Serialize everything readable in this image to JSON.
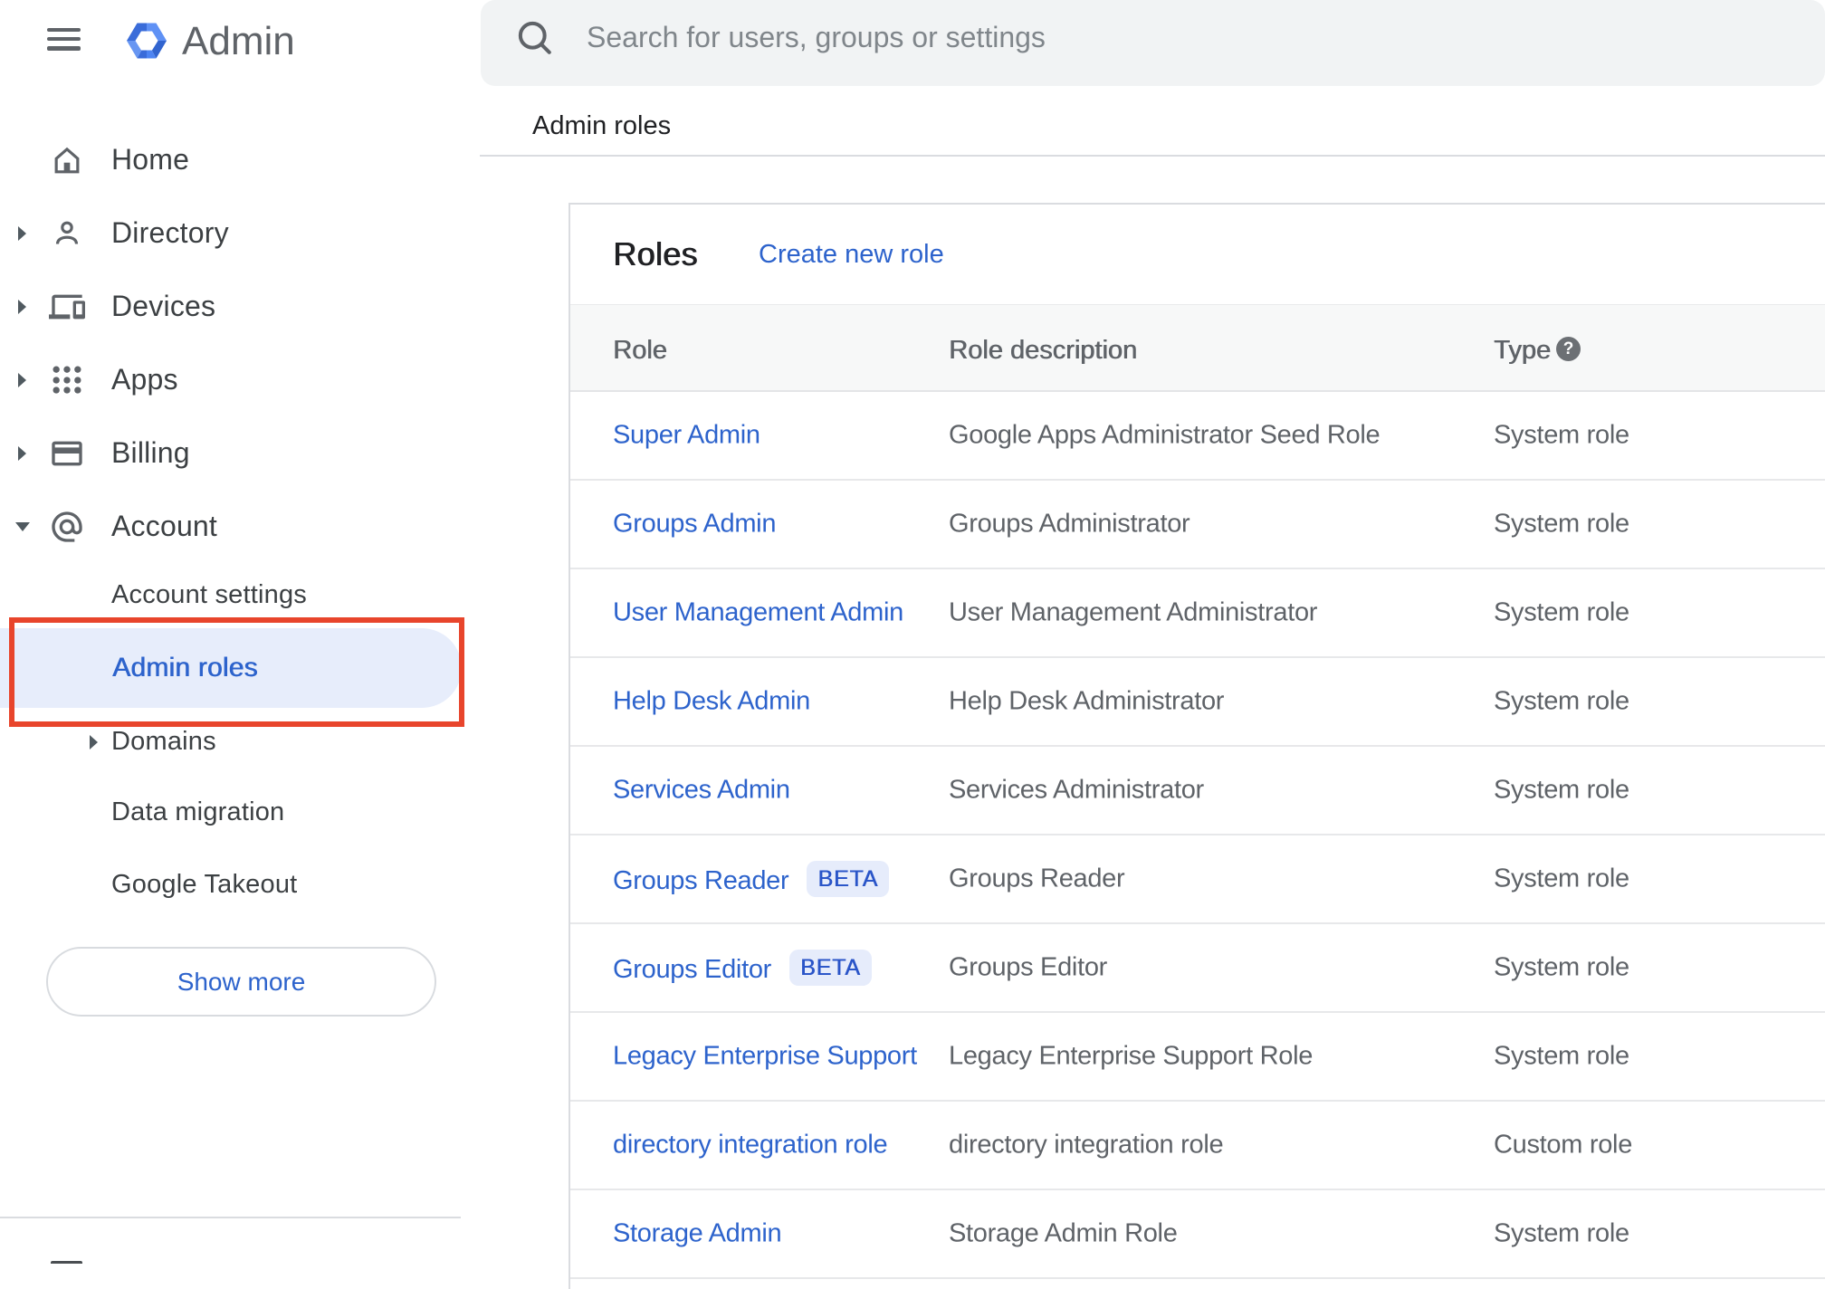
{
  "header": {
    "product_name": "Admin",
    "search_placeholder": "Search for users, groups or settings"
  },
  "breadcrumb": {
    "title": "Admin roles"
  },
  "sidebar": {
    "items": [
      {
        "label": "Home",
        "icon": "home-icon",
        "expandable": false
      },
      {
        "label": "Directory",
        "icon": "person-icon",
        "expandable": true
      },
      {
        "label": "Devices",
        "icon": "devices-icon",
        "expandable": true
      },
      {
        "label": "Apps",
        "icon": "apps-grid-icon",
        "expandable": true
      },
      {
        "label": "Billing",
        "icon": "credit-card-icon",
        "expandable": true
      },
      {
        "label": "Account",
        "icon": "at-sign-icon",
        "expandable": true,
        "expanded": true
      }
    ],
    "account_children": [
      {
        "label": "Account settings"
      },
      {
        "label": "Admin roles",
        "active": true
      },
      {
        "label": "Domains",
        "expandable": true
      },
      {
        "label": "Data migration"
      },
      {
        "label": "Google Takeout"
      }
    ],
    "show_more_label": "Show more"
  },
  "content": {
    "card_title": "Roles",
    "create_link": "Create new role",
    "table": {
      "columns": [
        "Role",
        "Role description",
        "Type"
      ],
      "rows": [
        {
          "role": "Super Admin",
          "description": "Google Apps Administrator Seed Role",
          "type": "System role"
        },
        {
          "role": "Groups Admin",
          "description": "Groups Administrator",
          "type": "System role"
        },
        {
          "role": "User Management Admin",
          "description": "User Management Administrator",
          "type": "System role"
        },
        {
          "role": "Help Desk Admin",
          "description": "Help Desk Administrator",
          "type": "System role"
        },
        {
          "role": "Services Admin",
          "description": "Services Administrator",
          "type": "System role"
        },
        {
          "role": "Groups Reader",
          "badge": "BETA",
          "description": "Groups Reader",
          "type": "System role"
        },
        {
          "role": "Groups Editor",
          "badge": "BETA",
          "description": "Groups Editor",
          "type": "System role"
        },
        {
          "role": "Legacy Enterprise Support",
          "description": "Legacy Enterprise Support Role",
          "type": "System role"
        },
        {
          "role": "directory integration role",
          "description": "directory integration role",
          "type": "Custom role"
        },
        {
          "role": "Storage Admin",
          "description": "Storage Admin Role",
          "type": "System role"
        }
      ]
    }
  },
  "annotation": {
    "highlight_color": "#e8452c"
  },
  "colors": {
    "link_blue": "#2d63cc",
    "active_pill_bg": "#e7edfb",
    "search_bg": "#f1f3f4",
    "icon_gray": "#5f6368",
    "text_dark": "#202124",
    "text_gray": "#5f6368"
  }
}
